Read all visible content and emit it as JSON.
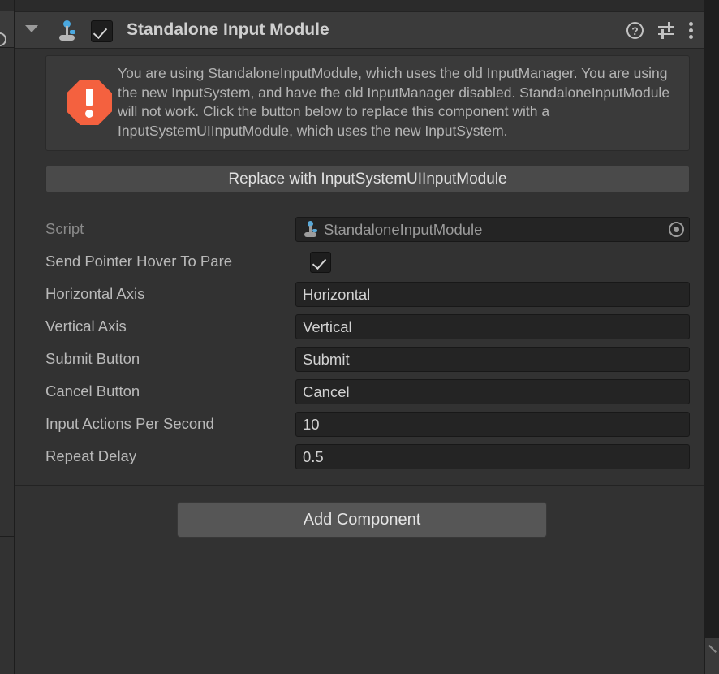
{
  "window": {
    "background_color": "#323232",
    "field_color": "#242424",
    "accent_warning_color": "#f4613f",
    "accent_blue_color": "#4aa8e0"
  },
  "component_header": {
    "title": "Standalone Input Module",
    "foldout_expanded": true,
    "enabled_checkbox": true,
    "icon": "input-module-icon",
    "actions": [
      {
        "name": "help-icon",
        "glyph": "?"
      },
      {
        "name": "preset-icon",
        "glyph": ""
      },
      {
        "name": "more-menu-icon",
        "glyph": ""
      }
    ]
  },
  "help_box": {
    "icon": "error-octagon-icon",
    "message": "You are using StandaloneInputModule, which uses the old InputManager. You are using the new InputSystem, and have the old InputManager disabled. StandaloneInputModule will not work. Click the button below to replace this component with a InputSystemUIInputModule, which uses the new InputSystem."
  },
  "replace_button": {
    "label": "Replace with InputSystemUIInputModule"
  },
  "properties": [
    {
      "name": "script",
      "label": "Script",
      "type": "object",
      "value": "StandaloneInputModule",
      "readonly": true,
      "icon": "script-icon",
      "picker": "object-picker-icon"
    },
    {
      "name": "send-pointer-hover-to-parent",
      "label": "Send Pointer Hover To Pare",
      "type": "checkbox",
      "value": true
    },
    {
      "name": "horizontal-axis",
      "label": "Horizontal Axis",
      "type": "text",
      "value": "Horizontal"
    },
    {
      "name": "vertical-axis",
      "label": "Vertical Axis",
      "type": "text",
      "value": "Vertical"
    },
    {
      "name": "submit-button",
      "label": "Submit Button",
      "type": "text",
      "value": "Submit"
    },
    {
      "name": "cancel-button",
      "label": "Cancel Button",
      "type": "text",
      "value": "Cancel"
    },
    {
      "name": "input-actions-per-second",
      "label": "Input Actions Per Second",
      "type": "number",
      "value": "10"
    },
    {
      "name": "repeat-delay",
      "label": "Repeat Delay",
      "type": "number",
      "value": "0.5"
    }
  ],
  "add_component_button": {
    "label": "Add Component"
  }
}
